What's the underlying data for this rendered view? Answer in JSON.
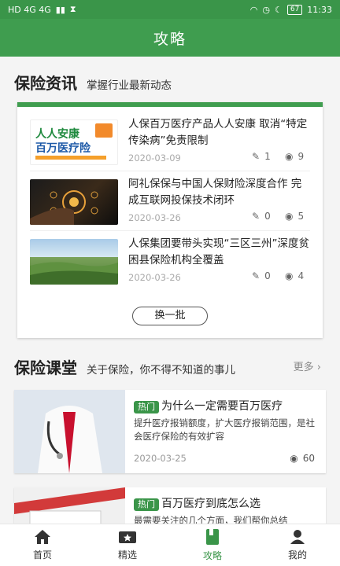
{
  "status": {
    "left": "HD 4G 4G",
    "battery": "67",
    "time": "11:33"
  },
  "header": {
    "title": "攻略"
  },
  "news_section": {
    "title": "保险资讯",
    "subtitle": "掌握行业最新动态",
    "items": [
      {
        "title": "人保百万医疗产品人人安康 取消“特定传染病”免责限制",
        "date": "2020-03-09",
        "edits": "1",
        "views": "9",
        "thumb_text_1": "人人安康",
        "thumb_text_2": "百万医疗险"
      },
      {
        "title": "阿礼保保与中国人保财险深度合作 完成互联网投保技术闭环",
        "date": "2020-03-26",
        "edits": "0",
        "views": "5"
      },
      {
        "title": "人保集团要带头实现“三区三州”深度贫困县保险机构全覆盖",
        "date": "2020-03-26",
        "edits": "0",
        "views": "4"
      }
    ],
    "refresh_label": "换一批"
  },
  "lesson_section": {
    "title": "保险课堂",
    "subtitle": "关于保险，你不得不知道的事儿",
    "more_label": "更多",
    "items": [
      {
        "tag": "热门",
        "title": "为什么一定需要百万医疗",
        "desc": "提升医疗报销额度，扩大医疗报销范围，是社会医疗保险的有效扩容",
        "date": "2020-03-25",
        "views": "60"
      },
      {
        "tag": "热门",
        "title": "百万医疗到底怎么选",
        "desc": "最需要关注的几个方面，我们帮你总结"
      }
    ]
  },
  "tabs": [
    {
      "label": "首页",
      "icon": "home-icon"
    },
    {
      "label": "精选",
      "icon": "star-card-icon"
    },
    {
      "label": "攻略",
      "icon": "book-icon",
      "active": true
    },
    {
      "label": "我的",
      "icon": "person-icon"
    }
  ],
  "colors": {
    "brand": "#3f9d4f",
    "status_bar": "#3a9549"
  }
}
